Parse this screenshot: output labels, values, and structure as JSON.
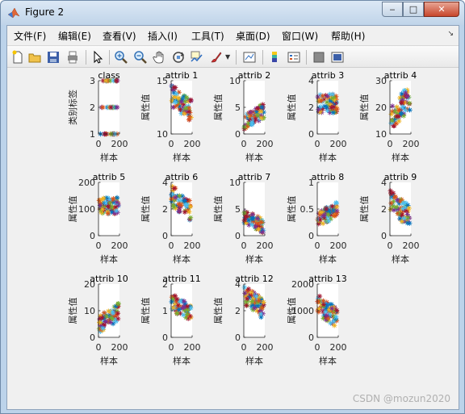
{
  "window": {
    "title": "Figure 2"
  },
  "menu": {
    "items": [
      "文件(F)",
      "编辑(E)",
      "查看(V)",
      "插入(I)",
      "工具(T)",
      "桌面(D)",
      "窗口(W)",
      "帮助(H)"
    ],
    "overflow_icon": "dock-arrow-icon"
  },
  "toolbar": {
    "buttons": [
      "new-figure-icon",
      "open-file-icon",
      "save-icon",
      "print-icon",
      "edit-plot-icon",
      "zoom-in-icon",
      "zoom-out-icon",
      "pan-icon",
      "rotate-3d-icon",
      "data-cursor-icon",
      "brush-icon",
      "link-plot-icon",
      "colorbar-icon",
      "legend-icon",
      "hide-plot-tools-icon",
      "show-plot-tools-icon"
    ]
  },
  "chart_data": [
    {
      "type": "scatter",
      "title": "class",
      "xlabel": "样本",
      "ylabel": "类别标签",
      "xlim": [
        0,
        200
      ],
      "ylim": [
        1,
        3
      ],
      "yticks": [
        "1",
        "2",
        "3"
      ],
      "xticks": [
        "0",
        "200"
      ],
      "series_count": 13,
      "cluster": [
        [
          1,
          1.02
        ],
        [
          2,
          2.02
        ],
        [
          3,
          3.0
        ]
      ]
    },
    {
      "type": "scatter",
      "title": "attrib 1",
      "xlabel": "样本",
      "ylabel": "属性值",
      "xlim": [
        0,
        200
      ],
      "ylim": [
        10,
        15
      ],
      "yticks": [
        "10",
        "15"
      ],
      "xticks": [
        "0",
        "200"
      ],
      "series_count": 13,
      "trend": "decreasing",
      "range": [
        11.0,
        14.8
      ]
    },
    {
      "type": "scatter",
      "title": "attrib 2",
      "xlabel": "样本",
      "ylabel": "属性值",
      "xlim": [
        0,
        200
      ],
      "ylim": [
        0,
        10
      ],
      "yticks": [
        "0",
        "5",
        "10"
      ],
      "xticks": [
        "0",
        "200"
      ],
      "series_count": 13,
      "trend": "increasing",
      "range": [
        0.8,
        5.8
      ]
    },
    {
      "type": "scatter",
      "title": "attrib 3",
      "xlabel": "样本",
      "ylabel": "属性值",
      "xlim": [
        0,
        200
      ],
      "ylim": [
        0,
        4
      ],
      "yticks": [
        "0",
        "2",
        "4"
      ],
      "xticks": [
        "0",
        "200"
      ],
      "series_count": 13,
      "trend": "flat",
      "range": [
        1.4,
        3.2
      ]
    },
    {
      "type": "scatter",
      "title": "attrib 4",
      "xlabel": "样本",
      "ylabel": "属性值",
      "xlim": [
        0,
        200
      ],
      "ylim": [
        10,
        30
      ],
      "yticks": [
        "10",
        "20",
        "30"
      ],
      "xticks": [
        "0",
        "200"
      ],
      "series_count": 13,
      "trend": "increasing",
      "range": [
        11,
        29
      ]
    },
    {
      "type": "scatter",
      "title": "attrib 5",
      "xlabel": "样本",
      "ylabel": "属性值",
      "xlim": [
        0,
        200
      ],
      "ylim": [
        0,
        200
      ],
      "yticks": [
        "0",
        "100",
        "200"
      ],
      "xticks": [
        "0",
        "200"
      ],
      "series_count": 13,
      "trend": "flat",
      "range": [
        75,
        150
      ]
    },
    {
      "type": "scatter",
      "title": "attrib 6",
      "xlabel": "样本",
      "ylabel": "属性值",
      "xlim": [
        0,
        200
      ],
      "ylim": [
        0,
        4
      ],
      "yticks": [
        "0",
        "2",
        "4"
      ],
      "xticks": [
        "0",
        "200"
      ],
      "series_count": 13,
      "trend": "decreasing",
      "range": [
        1.0,
        3.9
      ]
    },
    {
      "type": "scatter",
      "title": "attrib 7",
      "xlabel": "样本",
      "ylabel": "属性值",
      "xlim": [
        0,
        200
      ],
      "ylim": [
        0,
        10
      ],
      "yticks": [
        "0",
        "5",
        "10"
      ],
      "xticks": [
        "0",
        "200"
      ],
      "series_count": 13,
      "trend": "decreasing",
      "range": [
        0.3,
        5.1
      ]
    },
    {
      "type": "scatter",
      "title": "attrib 8",
      "xlabel": "样本",
      "ylabel": "属性值",
      "xlim": [
        0,
        200
      ],
      "ylim": [
        0,
        1
      ],
      "yticks": [
        "0",
        "0.5",
        "1"
      ],
      "xticks": [
        "0",
        "200"
      ],
      "series_count": 13,
      "trend": "increasing",
      "range": [
        0.15,
        0.65
      ]
    },
    {
      "type": "scatter",
      "title": "attrib 9",
      "xlabel": "样本",
      "ylabel": "属性值",
      "xlim": [
        0,
        200
      ],
      "ylim": [
        0,
        4
      ],
      "yticks": [
        "0",
        "2",
        "4"
      ],
      "xticks": [
        "0",
        "200"
      ],
      "series_count": 13,
      "trend": "decreasing",
      "range": [
        0.5,
        3.5
      ]
    },
    {
      "type": "scatter",
      "title": "attrib 10",
      "xlabel": "样本",
      "ylabel": "属性值",
      "xlim": [
        0,
        200
      ],
      "ylim": [
        0,
        20
      ],
      "yticks": [
        "0",
        "10",
        "20"
      ],
      "xticks": [
        "0",
        "200"
      ],
      "series_count": 13,
      "trend": "increasing",
      "range": [
        1.5,
        13
      ]
    },
    {
      "type": "scatter",
      "title": "attrib 11",
      "xlabel": "样本",
      "ylabel": "属性值",
      "xlim": [
        0,
        200
      ],
      "ylim": [
        0,
        2
      ],
      "yticks": [
        "0",
        "1",
        "2"
      ],
      "xticks": [
        "0",
        "200"
      ],
      "series_count": 13,
      "trend": "decreasing",
      "range": [
        0.5,
        1.7
      ]
    },
    {
      "type": "scatter",
      "title": "attrib 12",
      "xlabel": "样本",
      "ylabel": "属性值",
      "xlim": [
        0,
        200
      ],
      "ylim": [
        0,
        4
      ],
      "yticks": [
        "0",
        "2",
        "4"
      ],
      "xticks": [
        "0",
        "200"
      ],
      "series_count": 13,
      "trend": "decreasing",
      "range": [
        1.3,
        4.0
      ]
    },
    {
      "type": "scatter",
      "title": "attrib 13",
      "xlabel": "样本",
      "ylabel": "属性值",
      "xlim": [
        0,
        200
      ],
      "ylim": [
        0,
        2000
      ],
      "yticks": [
        "0",
        "1000",
        "2000"
      ],
      "xticks": [
        "0",
        "200"
      ],
      "series_count": 13,
      "trend": "decreasing",
      "range": [
        280,
        1680
      ]
    }
  ],
  "colors": {
    "series": [
      "#0072bd",
      "#d95319",
      "#edb120",
      "#7e2f8e",
      "#77ac30",
      "#4dbeee",
      "#a2142f"
    ]
  },
  "watermark": "CSDN @mozun2020"
}
